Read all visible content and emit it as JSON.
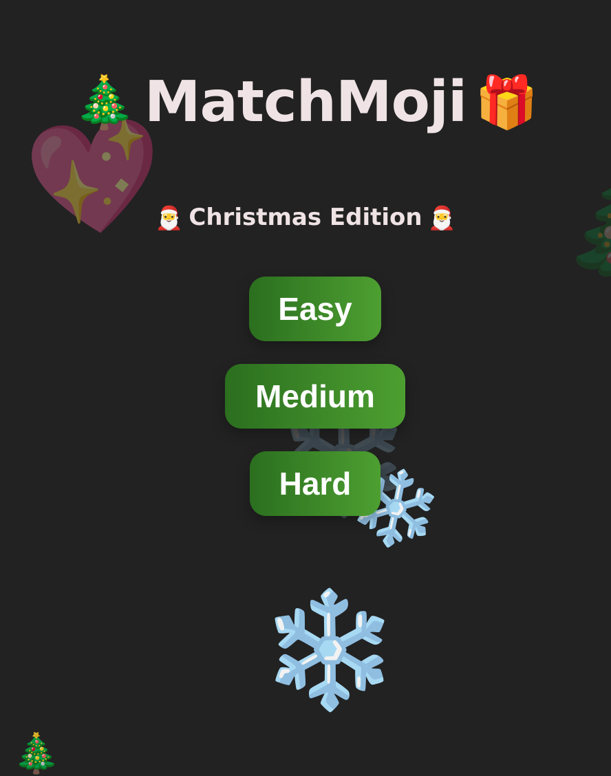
{
  "app": {
    "title": "MatchMoji",
    "title_left_icon": "christmas-tree-icon",
    "title_left_glyph": "🎄",
    "title_right_icon": "gift-icon",
    "title_right_glyph": "🎁",
    "subtitle": "Christmas Edition",
    "subtitle_left_icon": "santa-icon",
    "subtitle_left_glyph": "🎅",
    "subtitle_right_icon": "santa-icon",
    "subtitle_right_glyph": "🎅"
  },
  "difficulty": {
    "buttons": [
      {
        "label": "Easy"
      },
      {
        "label": "Medium"
      },
      {
        "label": "Hard"
      }
    ]
  },
  "background": {
    "items": [
      {
        "icon": "sparkling-heart-icon",
        "glyph": "💖"
      },
      {
        "icon": "christmas-tree-icon",
        "glyph": "🎄"
      },
      {
        "icon": "snowflake-icon",
        "glyph": "❄️"
      },
      {
        "icon": "snowflake-icon",
        "glyph": "❄️"
      },
      {
        "icon": "snowflake-icon",
        "glyph": "❄️"
      },
      {
        "icon": "ornament-icon",
        "glyph": "🎄"
      }
    ]
  },
  "colors": {
    "background": "#222222",
    "title_text": "#efe3e5",
    "button_gradient_start": "#2b6f1f",
    "button_gradient_end": "#4d9f31",
    "button_text": "#ffffff"
  }
}
